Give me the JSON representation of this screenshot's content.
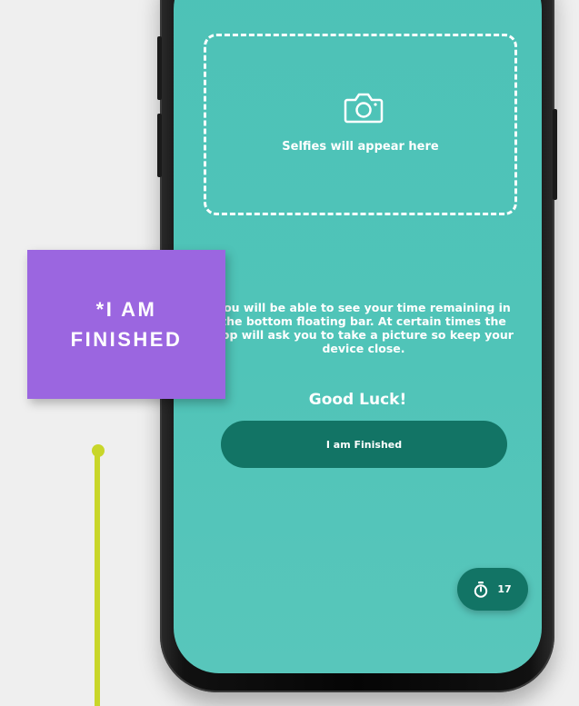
{
  "selfie_area": {
    "placeholder": "Selfies will appear here",
    "icon": "camera-icon"
  },
  "instructions": {
    "line1": "You will be able to see your time remaining in",
    "line2": "the bottom floating bar. At certain times the",
    "line3": "app will ask you to take a picture so keep your",
    "line4": "device close."
  },
  "greeting": "Good Luck!",
  "finish_button": {
    "label": "I am Finished"
  },
  "timer": {
    "icon": "stopwatch-icon",
    "value": "17"
  },
  "annotation": {
    "line1": "*I AM",
    "line2": "FINISHED"
  },
  "colors": {
    "screen": "#4dc2b7",
    "button": "#127465",
    "annotation": "#9b66e0",
    "pointer": "#c8d62a"
  }
}
